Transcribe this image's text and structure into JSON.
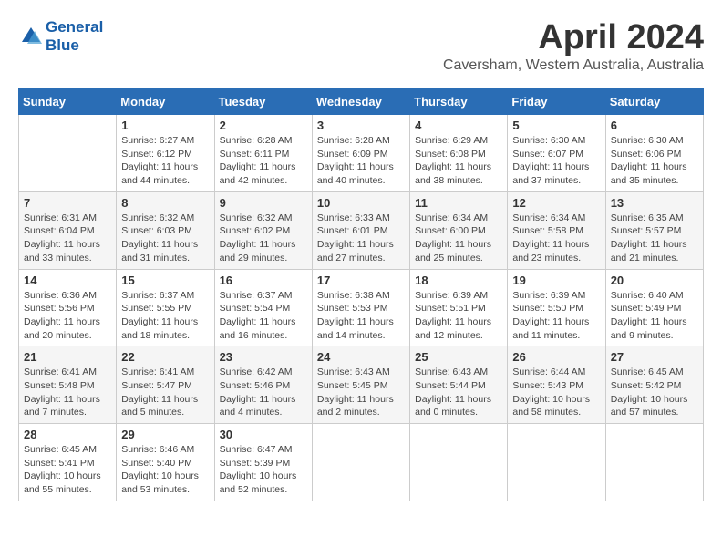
{
  "header": {
    "logo_line1": "General",
    "logo_line2": "Blue",
    "month": "April 2024",
    "location": "Caversham, Western Australia, Australia"
  },
  "days_of_week": [
    "Sunday",
    "Monday",
    "Tuesday",
    "Wednesday",
    "Thursday",
    "Friday",
    "Saturday"
  ],
  "weeks": [
    [
      {
        "day": "",
        "info": ""
      },
      {
        "day": "1",
        "info": "Sunrise: 6:27 AM\nSunset: 6:12 PM\nDaylight: 11 hours\nand 44 minutes."
      },
      {
        "day": "2",
        "info": "Sunrise: 6:28 AM\nSunset: 6:11 PM\nDaylight: 11 hours\nand 42 minutes."
      },
      {
        "day": "3",
        "info": "Sunrise: 6:28 AM\nSunset: 6:09 PM\nDaylight: 11 hours\nand 40 minutes."
      },
      {
        "day": "4",
        "info": "Sunrise: 6:29 AM\nSunset: 6:08 PM\nDaylight: 11 hours\nand 38 minutes."
      },
      {
        "day": "5",
        "info": "Sunrise: 6:30 AM\nSunset: 6:07 PM\nDaylight: 11 hours\nand 37 minutes."
      },
      {
        "day": "6",
        "info": "Sunrise: 6:30 AM\nSunset: 6:06 PM\nDaylight: 11 hours\nand 35 minutes."
      }
    ],
    [
      {
        "day": "7",
        "info": "Sunrise: 6:31 AM\nSunset: 6:04 PM\nDaylight: 11 hours\nand 33 minutes."
      },
      {
        "day": "8",
        "info": "Sunrise: 6:32 AM\nSunset: 6:03 PM\nDaylight: 11 hours\nand 31 minutes."
      },
      {
        "day": "9",
        "info": "Sunrise: 6:32 AM\nSunset: 6:02 PM\nDaylight: 11 hours\nand 29 minutes."
      },
      {
        "day": "10",
        "info": "Sunrise: 6:33 AM\nSunset: 6:01 PM\nDaylight: 11 hours\nand 27 minutes."
      },
      {
        "day": "11",
        "info": "Sunrise: 6:34 AM\nSunset: 6:00 PM\nDaylight: 11 hours\nand 25 minutes."
      },
      {
        "day": "12",
        "info": "Sunrise: 6:34 AM\nSunset: 5:58 PM\nDaylight: 11 hours\nand 23 minutes."
      },
      {
        "day": "13",
        "info": "Sunrise: 6:35 AM\nSunset: 5:57 PM\nDaylight: 11 hours\nand 21 minutes."
      }
    ],
    [
      {
        "day": "14",
        "info": "Sunrise: 6:36 AM\nSunset: 5:56 PM\nDaylight: 11 hours\nand 20 minutes."
      },
      {
        "day": "15",
        "info": "Sunrise: 6:37 AM\nSunset: 5:55 PM\nDaylight: 11 hours\nand 18 minutes."
      },
      {
        "day": "16",
        "info": "Sunrise: 6:37 AM\nSunset: 5:54 PM\nDaylight: 11 hours\nand 16 minutes."
      },
      {
        "day": "17",
        "info": "Sunrise: 6:38 AM\nSunset: 5:53 PM\nDaylight: 11 hours\nand 14 minutes."
      },
      {
        "day": "18",
        "info": "Sunrise: 6:39 AM\nSunset: 5:51 PM\nDaylight: 11 hours\nand 12 minutes."
      },
      {
        "day": "19",
        "info": "Sunrise: 6:39 AM\nSunset: 5:50 PM\nDaylight: 11 hours\nand 11 minutes."
      },
      {
        "day": "20",
        "info": "Sunrise: 6:40 AM\nSunset: 5:49 PM\nDaylight: 11 hours\nand 9 minutes."
      }
    ],
    [
      {
        "day": "21",
        "info": "Sunrise: 6:41 AM\nSunset: 5:48 PM\nDaylight: 11 hours\nand 7 minutes."
      },
      {
        "day": "22",
        "info": "Sunrise: 6:41 AM\nSunset: 5:47 PM\nDaylight: 11 hours\nand 5 minutes."
      },
      {
        "day": "23",
        "info": "Sunrise: 6:42 AM\nSunset: 5:46 PM\nDaylight: 11 hours\nand 4 minutes."
      },
      {
        "day": "24",
        "info": "Sunrise: 6:43 AM\nSunset: 5:45 PM\nDaylight: 11 hours\nand 2 minutes."
      },
      {
        "day": "25",
        "info": "Sunrise: 6:43 AM\nSunset: 5:44 PM\nDaylight: 11 hours\nand 0 minutes."
      },
      {
        "day": "26",
        "info": "Sunrise: 6:44 AM\nSunset: 5:43 PM\nDaylight: 10 hours\nand 58 minutes."
      },
      {
        "day": "27",
        "info": "Sunrise: 6:45 AM\nSunset: 5:42 PM\nDaylight: 10 hours\nand 57 minutes."
      }
    ],
    [
      {
        "day": "28",
        "info": "Sunrise: 6:45 AM\nSunset: 5:41 PM\nDaylight: 10 hours\nand 55 minutes."
      },
      {
        "day": "29",
        "info": "Sunrise: 6:46 AM\nSunset: 5:40 PM\nDaylight: 10 hours\nand 53 minutes."
      },
      {
        "day": "30",
        "info": "Sunrise: 6:47 AM\nSunset: 5:39 PM\nDaylight: 10 hours\nand 52 minutes."
      },
      {
        "day": "",
        "info": ""
      },
      {
        "day": "",
        "info": ""
      },
      {
        "day": "",
        "info": ""
      },
      {
        "day": "",
        "info": ""
      }
    ]
  ]
}
